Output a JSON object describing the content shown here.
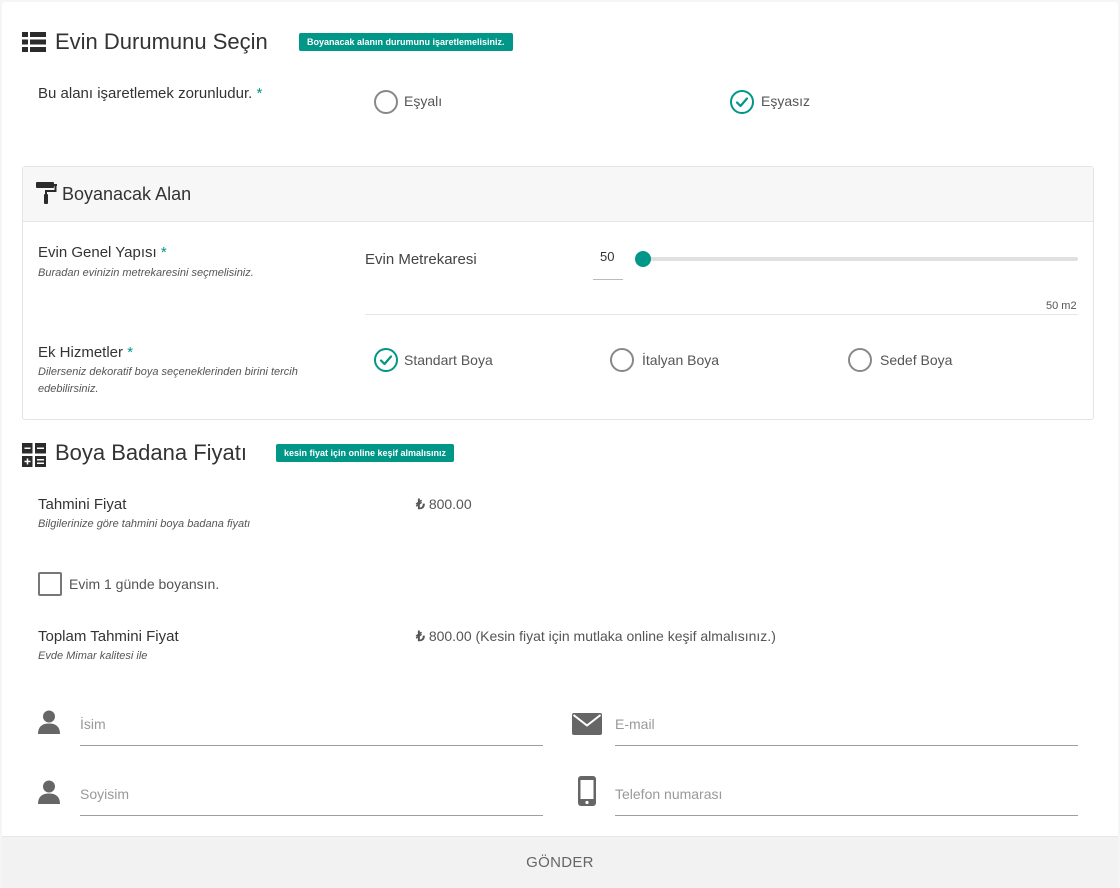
{
  "condition": {
    "title": "Evin Durumunu Seçin",
    "badge": "Boyanacak alanın durumunu işaretlemelisiniz.",
    "required_label": "Bu alanı işaretlemek zorunludur.",
    "required_mark": "*",
    "options": [
      {
        "label": "Eşyalı",
        "checked": false
      },
      {
        "label": "Eşyasız",
        "checked": true
      }
    ]
  },
  "area_panel": {
    "title": "Boyanacak Alan",
    "structure": {
      "label": "Evin Genel Yapısı",
      "required_mark": "*",
      "hint": "Buradan evinizin metrekaresini seçmelisiniz.",
      "slider_label": "Evin Metrekaresi",
      "value": "50",
      "value_fraction": 0.0,
      "caption": "50 m2"
    },
    "extras": {
      "label": "Ek Hizmetler",
      "required_mark": "*",
      "hint": "Dilerseniz dekoratif boya seçeneklerinden birini tercih edebilirsiniz.",
      "options": [
        {
          "label": "Standart Boya",
          "checked": true
        },
        {
          "label": "İtalyan Boya",
          "checked": false
        },
        {
          "label": "Sedef Boya",
          "checked": false
        }
      ]
    }
  },
  "price": {
    "title": "Boya Badana Fiyatı",
    "badge": "kesin fiyat için online keşif almalısınız",
    "estimate": {
      "label": "Tahmini Fiyat",
      "hint": "Bilgilerinize göre tahmini boya badana fiyatı",
      "currency": "₺",
      "value": "800.00"
    },
    "one_day": {
      "label": "Evim 1 günde boyansın.",
      "checked": false
    },
    "total": {
      "label": "Toplam Tahmini Fiyat",
      "hint": "Evde Mimar kalitesi ile",
      "currency": "₺",
      "value": "800.00 (Kesin fiyat için mutlaka online keşif almalısınız.)"
    }
  },
  "form": {
    "name_placeholder": "İsim",
    "email_placeholder": "E-mail",
    "surname_placeholder": "Soyisim",
    "phone_placeholder": "Telefon numarası",
    "submit_label": "GÖNDER"
  },
  "icons": {
    "section_list": "list-icon",
    "paint_roller": "paint-roller-icon",
    "calculator": "calculator-icon",
    "user": "user-icon",
    "envelope": "envelope-icon",
    "mobile": "mobile-phone-icon"
  },
  "colors": {
    "accent": "#009688",
    "text": "#333333",
    "muted": "#555555"
  }
}
